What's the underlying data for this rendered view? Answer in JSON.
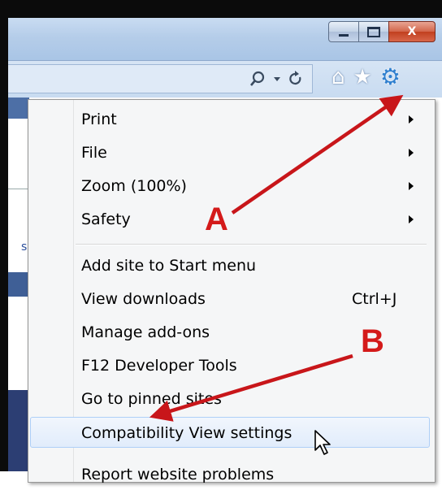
{
  "window": {
    "minimize_icon": "minimize-icon",
    "maximize_icon": "maximize-icon",
    "close_label": "X"
  },
  "toolbar": {
    "search_icon": "search-icon",
    "refresh_icon": "refresh-icon",
    "home_icon": "home-icon",
    "favorites_icon": "star-icon",
    "tools_icon": "gear-icon"
  },
  "background": {
    "partial_letter": "s"
  },
  "menu": {
    "items": [
      {
        "label": "Print",
        "submenu": true
      },
      {
        "label": "File",
        "submenu": true
      },
      {
        "label": "Zoom (100%)",
        "submenu": true
      },
      {
        "label": "Safety",
        "submenu": true
      },
      {
        "label": "Add site to Start menu"
      },
      {
        "label": "View downloads",
        "shortcut": "Ctrl+J"
      },
      {
        "label": "Manage add-ons"
      },
      {
        "label": "F12 Developer Tools"
      },
      {
        "label": "Go to pinned sites"
      },
      {
        "label": "Compatibility View settings",
        "highlighted": true
      },
      {
        "label": "Report website problems"
      }
    ]
  },
  "annotations": {
    "a_label": "A",
    "b_label": "B",
    "arrow_color": "#c8161a"
  }
}
